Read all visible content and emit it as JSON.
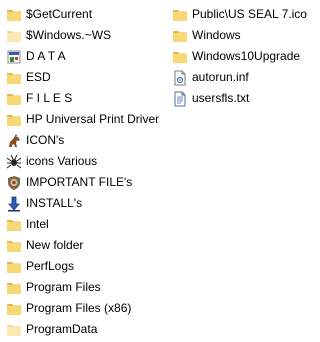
{
  "column_1": [
    {
      "name": "$GetCurrent",
      "icon": "folder-icon"
    },
    {
      "name": "$Windows.~WS",
      "icon": "folder-icon"
    },
    {
      "name": "D A T A",
      "icon": "custom-folder-icon"
    },
    {
      "name": "ESD",
      "icon": "folder-icon"
    },
    {
      "name": "F I L E S",
      "icon": "folder-icon"
    },
    {
      "name": "HP Universal Print Driver",
      "icon": "folder-icon"
    },
    {
      "name": "ICON's",
      "icon": "horse-icon"
    },
    {
      "name": "icons Various",
      "icon": "spider-icon"
    },
    {
      "name": "IMPORTANT FILE's",
      "icon": "badge-icon"
    },
    {
      "name": "INSTALL's",
      "icon": "install-arrow-icon"
    },
    {
      "name": "Intel",
      "icon": "folder-icon"
    },
    {
      "name": "New folder",
      "icon": "folder-icon"
    },
    {
      "name": "PerfLogs",
      "icon": "folder-icon"
    },
    {
      "name": "Program Files",
      "icon": "folder-icon"
    },
    {
      "name": "Program Files (x86)",
      "icon": "folder-icon"
    },
    {
      "name": "ProgramData",
      "icon": "folder-icon"
    }
  ],
  "column_2": [
    {
      "name": "Public\\US SEAL 7.ico",
      "icon": "folder-icon"
    },
    {
      "name": "Windows",
      "icon": "folder-icon"
    },
    {
      "name": "Windows10Upgrade",
      "icon": "folder-icon"
    },
    {
      "name": "autorun.inf",
      "icon": "settings-file-icon"
    },
    {
      "name": "usersfls.txt",
      "icon": "text-file-icon"
    }
  ],
  "colors": {
    "folder_body": "#f8d775",
    "folder_tab": "#e8b84a",
    "text": "#000000"
  }
}
